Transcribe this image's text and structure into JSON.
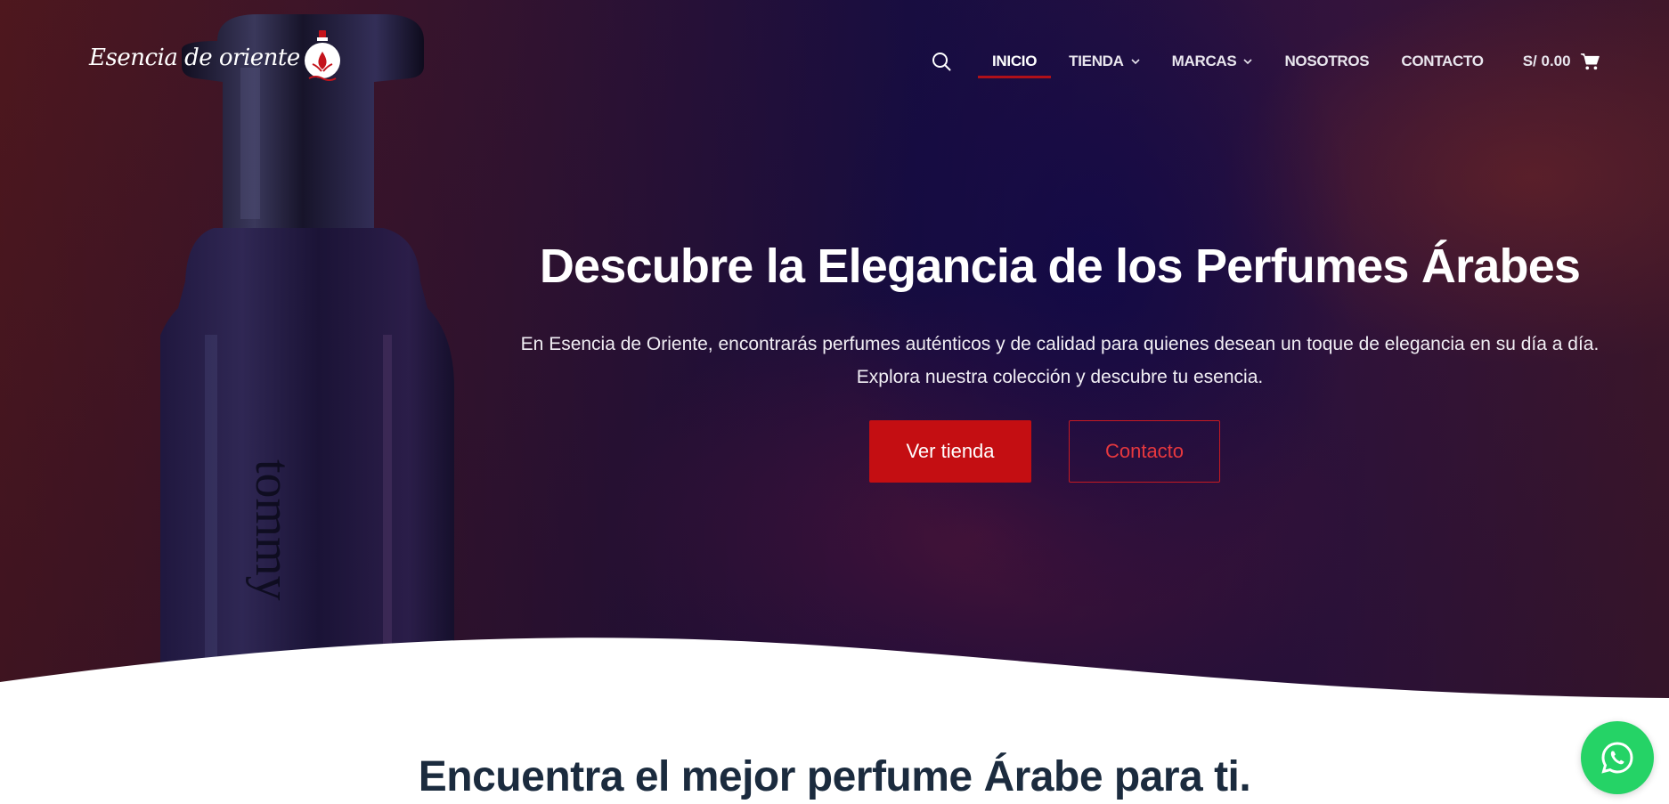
{
  "brand": {
    "name": "Esencia de oriente",
    "logo_icon": "perfume-flask-icon"
  },
  "nav": {
    "items": [
      {
        "label": "INICIO",
        "active": true,
        "dropdown": false
      },
      {
        "label": "TIENDA",
        "active": false,
        "dropdown": true
      },
      {
        "label": "MARCAS",
        "active": false,
        "dropdown": true
      },
      {
        "label": "NOSOTROS",
        "active": false,
        "dropdown": false
      },
      {
        "label": "CONTACTO",
        "active": false,
        "dropdown": false
      }
    ],
    "search_icon": "search-icon",
    "cart_total": "S/ 0.00",
    "cart_icon": "cart-icon"
  },
  "hero": {
    "title": "Descubre la Elegancia de los Perfumes Árabes",
    "subtitle_line1": "En Esencia de Oriente, encontrarás perfumes auténticos y de calidad para quienes desean un toque de elegancia en su día a día.",
    "subtitle_line2": "Explora nuestra colección y descubre tu esencia.",
    "primary_button": "Ver tienda",
    "secondary_button": "Contacto",
    "bottle_engraving": "tommy"
  },
  "section": {
    "title": "Encuentra el mejor perfume Árabe para ti."
  },
  "whatsapp": {
    "icon": "whatsapp-icon"
  },
  "colors": {
    "accent": "#c40e12",
    "heading": "#1b2b3e",
    "whatsapp": "#25d366"
  }
}
